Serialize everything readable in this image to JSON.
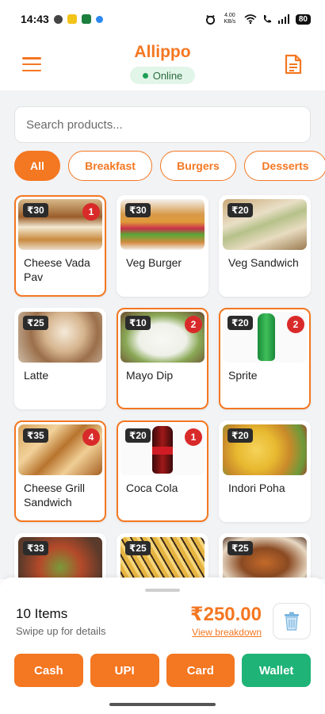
{
  "status_bar": {
    "time": "14:43",
    "network_speed": "4.00 KB/s",
    "battery": "80"
  },
  "header": {
    "title": "Allippo",
    "status": "Online",
    "menu_icon": "hamburger-menu-icon",
    "orders_icon": "document-icon"
  },
  "search": {
    "placeholder": "Search products...",
    "value": ""
  },
  "categories": [
    {
      "label": "All",
      "active": true
    },
    {
      "label": "Breakfast",
      "active": false
    },
    {
      "label": "Burgers",
      "active": false
    },
    {
      "label": "Desserts",
      "active": false
    }
  ],
  "products": [
    {
      "name": "Cheese Vada Pav",
      "price": "₹30",
      "qty": "1",
      "image": "vada-pav-photo"
    },
    {
      "name": "Veg Burger",
      "price": "₹30",
      "qty": "",
      "image": "burger-photo"
    },
    {
      "name": "Veg Sandwich",
      "price": "₹20",
      "qty": "",
      "image": "sandwich-photo"
    },
    {
      "name": "Latte",
      "price": "₹25",
      "qty": "",
      "image": "latte-photo"
    },
    {
      "name": "Mayo Dip",
      "price": "₹10",
      "qty": "2",
      "image": "mayo-dip-photo"
    },
    {
      "name": "Sprite",
      "price": "₹20",
      "qty": "2",
      "image": "sprite-bottle-photo"
    },
    {
      "name": "Cheese Grill Sandwich",
      "price": "₹35",
      "qty": "4",
      "image": "grill-sandwich-photo"
    },
    {
      "name": "Coca Cola",
      "price": "₹20",
      "qty": "1",
      "image": "coca-cola-bottle-photo"
    },
    {
      "name": "Indori Poha",
      "price": "₹20",
      "qty": "",
      "image": "poha-photo"
    },
    {
      "name": "",
      "price": "₹33",
      "qty": "",
      "image": "salad-photo"
    },
    {
      "name": "",
      "price": "₹25",
      "qty": "",
      "image": "fries-photo"
    },
    {
      "name": "",
      "price": "₹25",
      "qty": "",
      "image": "kebab-roll-photo"
    }
  ],
  "cart": {
    "items_count": "10 Items",
    "hint": "Swipe up for details",
    "total": "₹250.00",
    "breakdown_link": "View breakdown",
    "clear_icon": "trash-icon"
  },
  "payment_methods": [
    {
      "label": "Cash",
      "color": "#f47721"
    },
    {
      "label": "UPI",
      "color": "#f47721"
    },
    {
      "label": "Card",
      "color": "#f47721"
    },
    {
      "label": "Wallet",
      "color": "#1fb377"
    }
  ],
  "colors": {
    "accent": "#f47721",
    "online": "#1e9e55",
    "wallet": "#1fb377",
    "badge": "#d92a2a"
  }
}
